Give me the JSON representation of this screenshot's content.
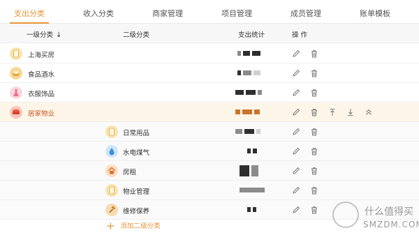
{
  "tabs": [
    {
      "label": "支出分类",
      "active": true
    },
    {
      "label": "收入分类",
      "active": false
    },
    {
      "label": "商家管理",
      "active": false
    },
    {
      "label": "项目管理",
      "active": false
    },
    {
      "label": "成员管理",
      "active": false
    },
    {
      "label": "账单模板",
      "active": false
    }
  ],
  "header": {
    "level1": "一级分类",
    "level2": "二级分类",
    "stats": "支出统计",
    "ops": "操 作"
  },
  "rows": [
    {
      "level1": "上海买房",
      "icon": "document-icon"
    },
    {
      "level1": "食品酒水",
      "icon": "food-icon"
    },
    {
      "level1": "衣服饰品",
      "icon": "dress-icon"
    },
    {
      "level1": "居家物业",
      "icon": "sofa-icon",
      "expanded": true
    },
    {
      "level2": "日常用品",
      "icon": "document-icon"
    },
    {
      "level2": "水电煤气",
      "icon": "water-drop-icon"
    },
    {
      "level2": "房租",
      "icon": "house-icon"
    },
    {
      "level2": "物业管理",
      "icon": "document-icon"
    },
    {
      "level2": "维修保养",
      "icon": "hammer-icon"
    }
  ],
  "add_sub_label": "添加二级分类",
  "watermark": {
    "text": "什么值得买",
    "sub": "SMZDM.COM"
  },
  "colors": {
    "accent": "#e8963a",
    "highlight": "#fdf6e8",
    "active_text": "#c8592a"
  }
}
